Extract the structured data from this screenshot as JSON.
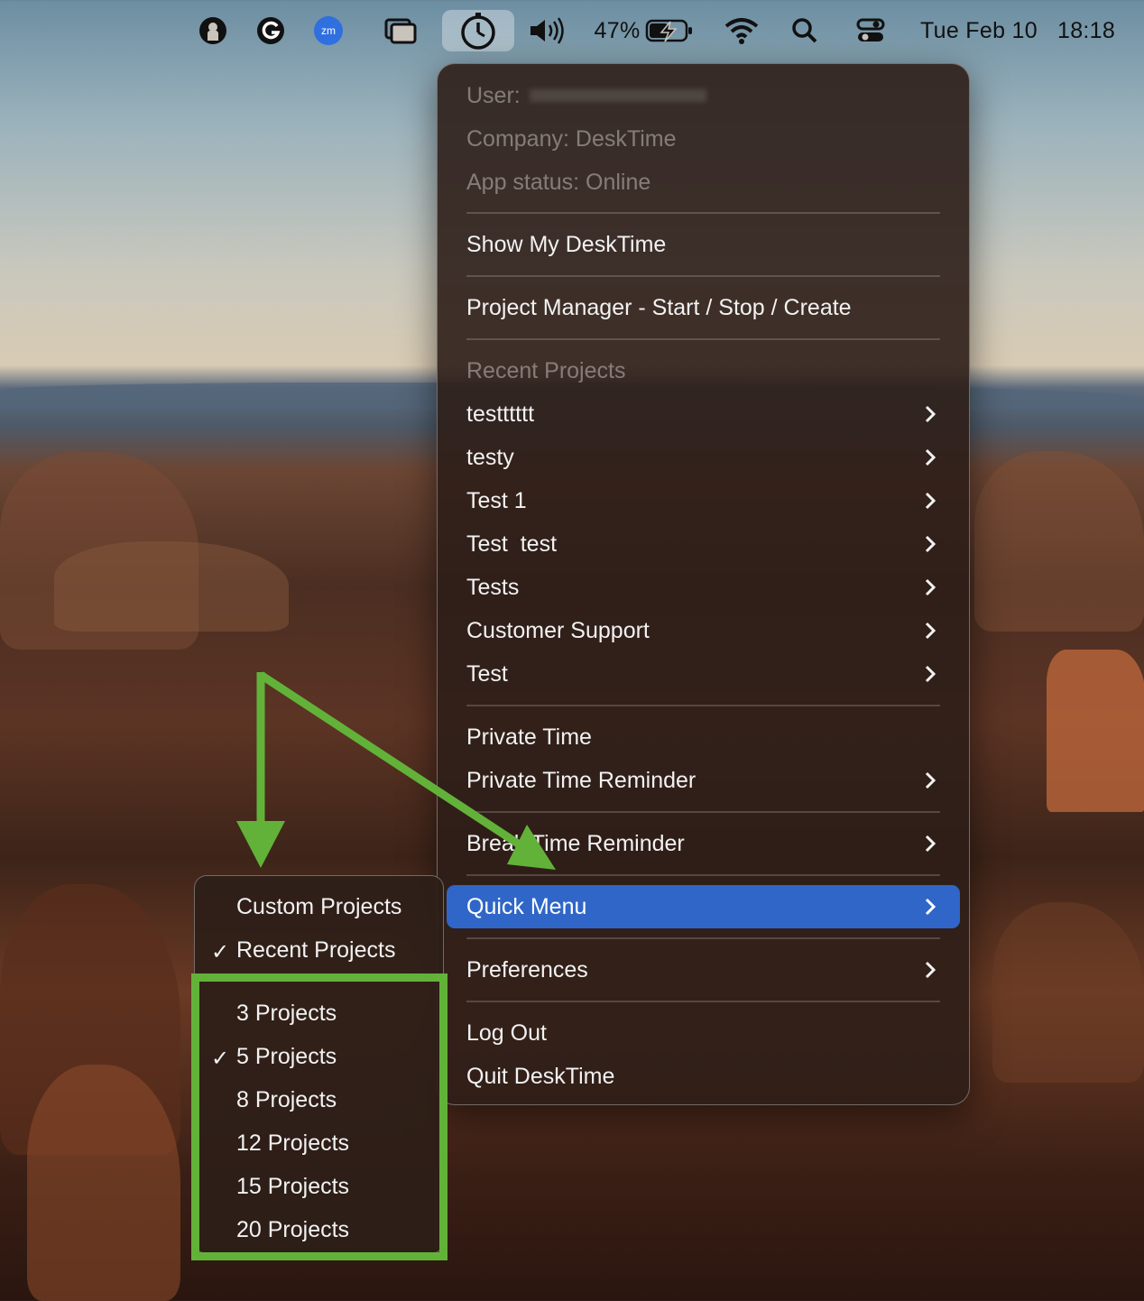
{
  "menubar": {
    "battery_percent": "47%",
    "datetime_day": "Tue Feb 10",
    "datetime_time": "18:18",
    "icons": [
      "github-icon",
      "grammarly-icon",
      "zoom-icon",
      "window-icon",
      "desktime-clock-icon",
      "volume-icon",
      "battery-icon",
      "wifi-icon",
      "spotlight-icon",
      "control-center-icon"
    ]
  },
  "menu": {
    "user_label": "User:",
    "company": "Company: DeskTime",
    "app_status": "App status: Online",
    "show_my_desktime": "Show My DeskTime",
    "project_manager": "Project Manager - Start / Stop / Create",
    "recent_projects_header": "Recent Projects",
    "recent_projects": [
      "testttttt",
      "testy",
      "Test 1",
      "Test  test",
      "Tests",
      "Customer Support",
      "Test"
    ],
    "private_time": "Private Time",
    "private_time_reminder": "Private Time Reminder",
    "break_time_reminder": "Break Time Reminder",
    "quick_menu": "Quick Menu",
    "preferences": "Preferences",
    "log_out": "Log Out",
    "quit": "Quit DeskTime"
  },
  "submenu": {
    "custom_projects": "Custom Projects",
    "recent_projects": "Recent Projects",
    "checkmark": "✓",
    "counts": [
      "3 Projects",
      "5 Projects",
      "8 Projects",
      "12 Projects",
      "15 Projects",
      "20 Projects"
    ],
    "selected_count_index": 1,
    "selected_mode": "Recent Projects"
  },
  "colors": {
    "highlight": "#2f66c8",
    "annotation_green": "#62b239"
  }
}
